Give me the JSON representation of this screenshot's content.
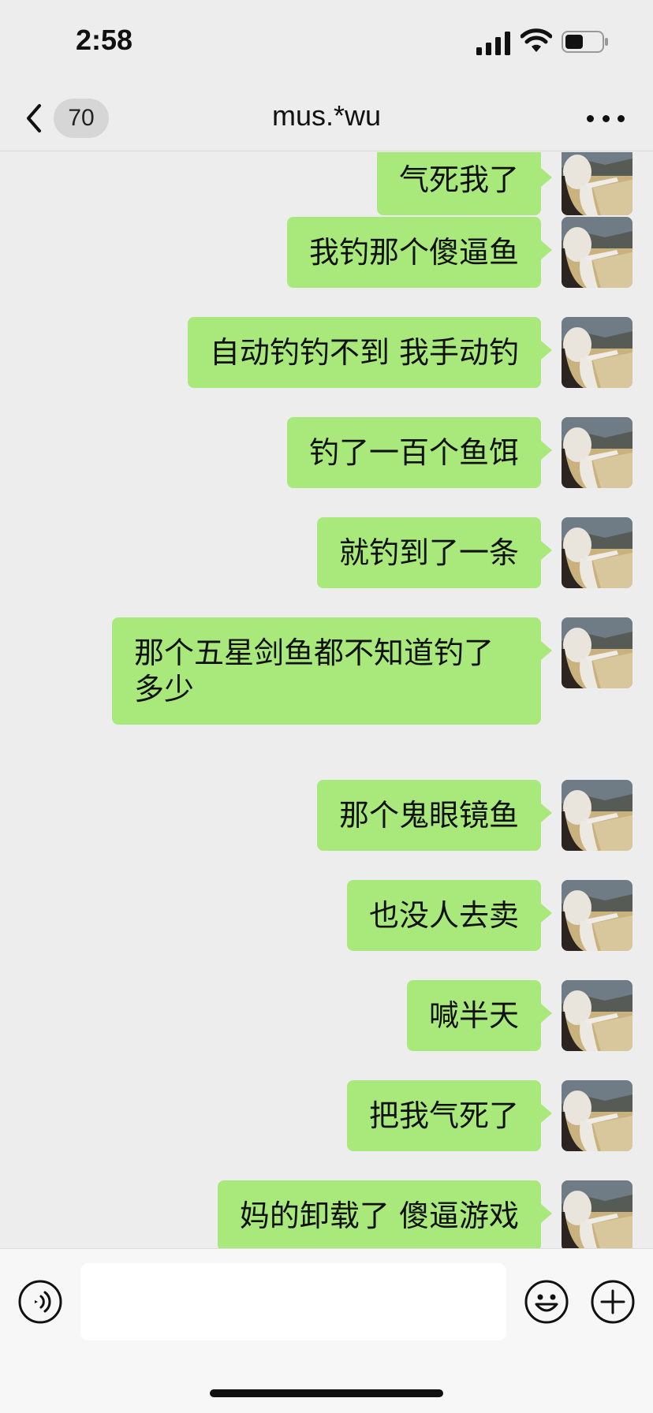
{
  "status_bar": {
    "time": "2:58",
    "icons": [
      "signal-icon",
      "wifi-icon",
      "battery-icon"
    ]
  },
  "header": {
    "back_icon": "chevron-left-icon",
    "unread_count": "70",
    "title": "mus.*wu",
    "more_icon": "more-dots-icon"
  },
  "messages": [
    {
      "text": "气死我了",
      "sender": "self"
    },
    {
      "text": "我钓那个傻逼鱼",
      "sender": "self"
    },
    {
      "text": "自动钓钓不到 我手动钓",
      "sender": "self"
    },
    {
      "text": "钓了一百个鱼饵",
      "sender": "self"
    },
    {
      "text": "就钓到了一条",
      "sender": "self"
    },
    {
      "text": "那个五星剑鱼都不知道钓了多少",
      "sender": "self"
    },
    {
      "text": "那个鬼眼镜鱼",
      "sender": "self"
    },
    {
      "text": "也没人去卖",
      "sender": "self"
    },
    {
      "text": "喊半天",
      "sender": "self"
    },
    {
      "text": "把我气死了",
      "sender": "self"
    },
    {
      "text": "妈的卸载了 傻逼游戏",
      "sender": "self"
    }
  ],
  "input_bar": {
    "voice_icon": "voice-icon",
    "input_value": "",
    "emoji_icon": "emoji-icon",
    "add_icon": "plus-circle-icon"
  },
  "colors": {
    "bubble_self": "#a9e97b",
    "background": "#ededed"
  }
}
